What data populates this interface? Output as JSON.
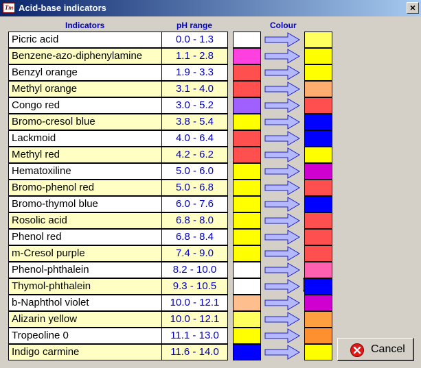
{
  "window": {
    "title": "Acid-base indicators",
    "icon_text": "Tm",
    "close_symbol": "×"
  },
  "headers": {
    "indicators": "Indicators",
    "ph_range": "pH range",
    "colour": "Colour"
  },
  "rows": [
    {
      "name": "Picric acid",
      "range": "0.0 - 1.3",
      "acid_color": "#ffffff",
      "base_color": "#ffff60"
    },
    {
      "name": "Benzene-azo-diphenylamine",
      "range": "1.1 - 2.8",
      "acid_color": "#ff40e0",
      "base_color": "#ffff00"
    },
    {
      "name": "Benzyl orange",
      "range": "1.9 - 3.3",
      "acid_color": "#ff4f4f",
      "base_color": "#ffff00"
    },
    {
      "name": "Methyl orange",
      "range": "3.1 - 4.0",
      "acid_color": "#ff4f4f",
      "base_color": "#ffae70"
    },
    {
      "name": "Congo red",
      "range": "3.0 - 5.2",
      "acid_color": "#a060ff",
      "base_color": "#ff4f4f"
    },
    {
      "name": "Bromo-cresol blue",
      "range": "3.8 - 5.4",
      "acid_color": "#ffff00",
      "base_color": "#0000ff"
    },
    {
      "name": "Lackmoid",
      "range": "4.0 - 6.4",
      "acid_color": "#ff4f4f",
      "base_color": "#0000ff"
    },
    {
      "name": "Methyl red",
      "range": "4.2 - 6.2",
      "acid_color": "#ff4f4f",
      "base_color": "#ffff00"
    },
    {
      "name": "Hematoxiline",
      "range": "5.0 - 6.0",
      "acid_color": "#ffff00",
      "base_color": "#d000d0"
    },
    {
      "name": "Bromo-phenol red",
      "range": "5.0 - 6.8",
      "acid_color": "#ffff00",
      "base_color": "#ff4f4f"
    },
    {
      "name": "Bromo-thymol blue",
      "range": "6.0 - 7.6",
      "acid_color": "#ffff00",
      "base_color": "#0000ff"
    },
    {
      "name": "Rosolic acid",
      "range": "6.8 - 8.0",
      "acid_color": "#ffff00",
      "base_color": "#ff4f4f"
    },
    {
      "name": "Phenol red",
      "range": "6.8 - 8.4",
      "acid_color": "#ffff00",
      "base_color": "#ff4f4f"
    },
    {
      "name": "m-Cresol purple",
      "range": "7.4 - 9.0",
      "acid_color": "#ffff00",
      "base_color": "#ff4f4f"
    },
    {
      "name": "Phenol-phthalein",
      "range": "8.2 - 10.0",
      "acid_color": "#ffffff",
      "base_color": "#ff60b0"
    },
    {
      "name": "Thymol-phthalein",
      "range": "9.3 - 10.5",
      "acid_color": "#ffffff",
      "base_color": "#0000ff"
    },
    {
      "name": "b-Naphthol violet",
      "range": "10.0 - 12.1",
      "acid_color": "#ffbe8e",
      "base_color": "#d000d0"
    },
    {
      "name": "Alizarin yellow",
      "range": "10.0 - 12.1",
      "acid_color": "#ffff60",
      "base_color": "#ffa040"
    },
    {
      "name": "Tropeoline 0",
      "range": "11.1 - 13.0",
      "acid_color": "#ffff00",
      "base_color": "#ff9030"
    },
    {
      "name": "Indigo carmine",
      "range": "11.6 - 14.0",
      "acid_color": "#0000ff",
      "base_color": "#ffff00"
    }
  ],
  "cancel_button": {
    "label": "Cancel"
  },
  "colors": {
    "title_bar_start": "#0a246a",
    "arrow": "#b4b8ff",
    "header_text": "#0000c0"
  }
}
